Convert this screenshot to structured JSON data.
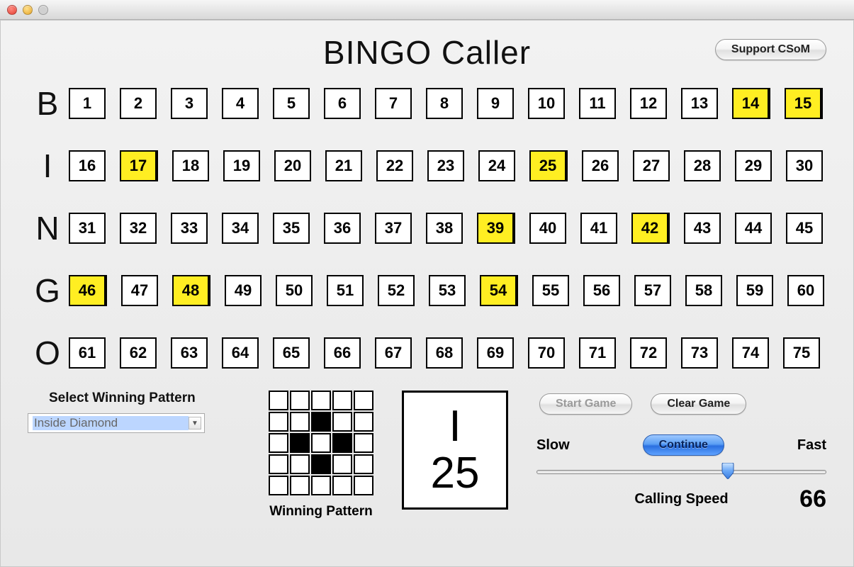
{
  "title": "BINGO Caller",
  "support_label": "Support CSoM",
  "letters": [
    "B",
    "I",
    "N",
    "G",
    "O"
  ],
  "rows": [
    {
      "letter": "B",
      "start": 1,
      "end": 15
    },
    {
      "letter": "I",
      "start": 16,
      "end": 30
    },
    {
      "letter": "N",
      "start": 31,
      "end": 45
    },
    {
      "letter": "G",
      "start": 46,
      "end": 60
    },
    {
      "letter": "O",
      "start": 61,
      "end": 75
    }
  ],
  "called_numbers": [
    14,
    15,
    17,
    25,
    39,
    42,
    46,
    48,
    54
  ],
  "pattern": {
    "select_label": "Select Winning Pattern",
    "selected": "Inside Diamond",
    "caption": "Winning Pattern",
    "grid": [
      [
        0,
        0,
        0,
        0,
        0
      ],
      [
        0,
        0,
        1,
        0,
        0
      ],
      [
        0,
        1,
        0,
        1,
        0
      ],
      [
        0,
        0,
        1,
        0,
        0
      ],
      [
        0,
        0,
        0,
        0,
        0
      ]
    ]
  },
  "current": {
    "letter": "I",
    "number": "25"
  },
  "controls": {
    "start_label": "Start Game",
    "start_disabled": true,
    "clear_label": "Clear Game",
    "continue_label": "Continue",
    "slow_label": "Slow",
    "fast_label": "Fast",
    "speed_title": "Calling Speed",
    "speed_value": "66",
    "speed_percent": 66
  }
}
